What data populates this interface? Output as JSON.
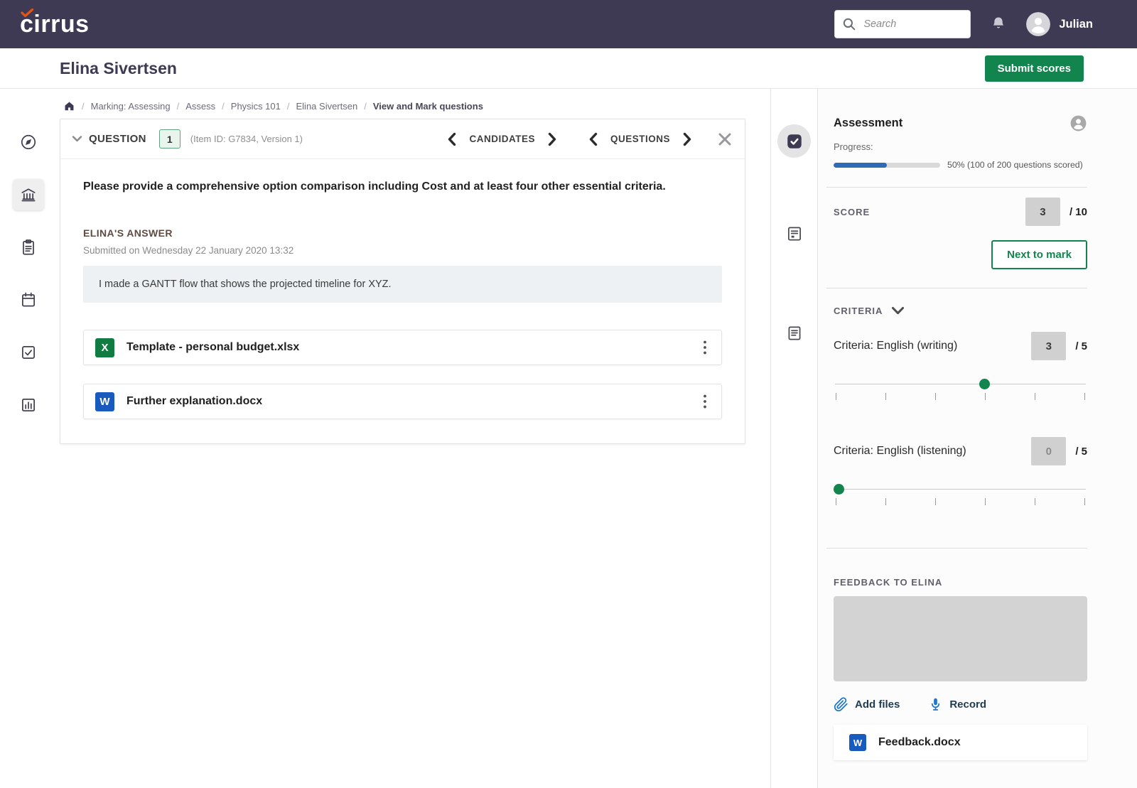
{
  "topbar": {
    "logo": "cirrus",
    "search_placeholder": "Search",
    "user_name": "Julian"
  },
  "subheader": {
    "title": "Elina Sivertsen",
    "submit_button": "Submit scores"
  },
  "breadcrumb": {
    "items": [
      "Marking: Assessing",
      "Assess",
      "Physics 101",
      "Elina Sivertsen",
      "View and Mark questions"
    ]
  },
  "question_card": {
    "header_label": "QUESTION",
    "question_number": "1",
    "item_meta": "(Item ID: G7834, Version 1)",
    "candidates_label": "CANDIDATES",
    "questions_label": "QUESTIONS",
    "question_text": "Please provide a comprehensive option comparison including Cost and at least four other essential criteria.",
    "answer_heading": "ELINA'S ANSWER",
    "submitted_text": "Submitted on Wednesday 22 January 2020 13:32",
    "answer_text": "I made a GANTT flow that shows the projected timeline for XYZ.",
    "attachments": [
      {
        "name": "Template - personal budget.xlsx",
        "badge": "X",
        "type": "excel"
      },
      {
        "name": "Further explanation.docx",
        "badge": "W",
        "type": "word"
      }
    ]
  },
  "assessment_panel": {
    "title": "Assessment",
    "progress_label": "Progress:",
    "progress_percent": 50,
    "progress_text": "50% (100 of 200 questions scored)",
    "score": {
      "label": "SCORE",
      "value": "3",
      "max": "/ 10"
    },
    "next_button": "Next to mark",
    "criteria_label": "CRITERIA",
    "criteria": [
      {
        "label": "Criteria: English (writing)",
        "value": "3",
        "max": "/ 5",
        "position": 3,
        "steps": 5
      },
      {
        "label": "Criteria: English (listening)",
        "value": "0",
        "max": "/ 5",
        "position": 0,
        "steps": 5
      }
    ],
    "feedback_label": "FEEDBACK TO ELINA",
    "add_files_label": "Add files",
    "record_label": "Record",
    "feedback_file": {
      "name": "Feedback.docx",
      "badge": "W",
      "type": "word"
    }
  },
  "icons": {
    "logo_check": "orange-check",
    "search": "magnifier",
    "notifications": "bell",
    "avatar": "person-circle",
    "home": "house",
    "rail": [
      "compass",
      "institution",
      "clipboard",
      "calendar",
      "checkbox",
      "bar-chart"
    ],
    "strip": [
      "check-badge",
      "scorecard",
      "notes"
    ],
    "kebab": "vertical-ellipsis",
    "add_files": "paperclip",
    "record": "microphone",
    "file_types": {
      "xlsx": "excel-green",
      "docx": "word-blue"
    }
  },
  "colors": {
    "topbar_bg": "#3e3a53",
    "accent_green": "#12854e",
    "progress_blue": "#2d6cb5",
    "excel_green": "#107c41",
    "word_blue": "#185abd",
    "answer_box_bg": "#edf1f4"
  }
}
